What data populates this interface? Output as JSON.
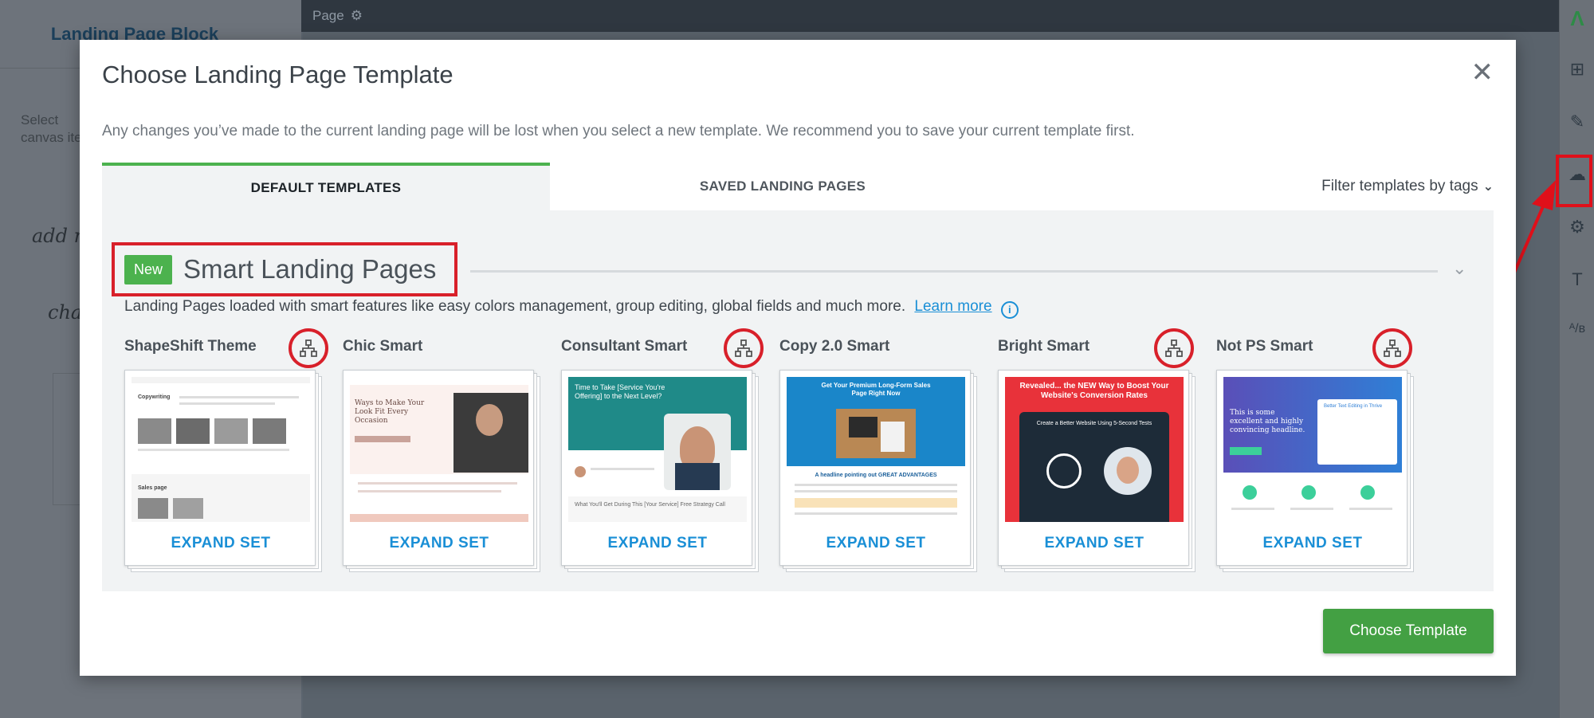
{
  "editor": {
    "left_panel_title": "Landing Page Block",
    "left_panel_hint": "Select canvas ite",
    "left_panel_script_1": "add n elem",
    "left_panel_script_2": "cha tem",
    "topbar_label": "Page"
  },
  "modal": {
    "title": "Choose Landing Page Template",
    "warning": "Any changes you’ve made to the current landing page will be lost when you select a new template. We recommend you to save your current template first.",
    "tabs": [
      {
        "label": "DEFAULT TEMPLATES",
        "active": true
      },
      {
        "label": "SAVED LANDING PAGES",
        "active": false
      }
    ],
    "filter_label": "Filter templates by tags",
    "section": {
      "badge": "New",
      "title": "Smart Landing Pages",
      "description": "Landing Pages loaded with smart features like easy colors management, group editing, global fields and much more.",
      "learn_more": "Learn more",
      "info_glyph": "i"
    },
    "templates": [
      {
        "name": "ShapeShift Theme",
        "expand_label": "EXPAND SET",
        "structure_marked": true
      },
      {
        "name": "Chic Smart",
        "expand_label": "EXPAND SET",
        "structure_marked": false
      },
      {
        "name": "Consultant Smart",
        "expand_label": "EXPAND SET",
        "structure_marked": true
      },
      {
        "name": "Copy 2.0 Smart",
        "expand_label": "EXPAND SET",
        "structure_marked": false
      },
      {
        "name": "Bright Smart",
        "expand_label": "EXPAND SET",
        "structure_marked": true
      },
      {
        "name": "Not PS Smart",
        "expand_label": "EXPAND SET",
        "structure_marked": true
      }
    ],
    "thumbnail_text": {
      "chic_headline": "Ways to Make Your Look Fit Every Occasion",
      "consultant_headline": "Time to Take [Service You're Offering] to the Next Level?",
      "consultant_footer": "What You'll Get During This [Your Service] Free Strategy Call",
      "copy_headline": "Get Your Premium Long-Form Sales Page Right Now",
      "copy_sub": "A headline pointing out GREAT ADVANTAGES",
      "bright_headline": "Revealed... the NEW Way to Boost Your Website's Conversion Rates",
      "bright_sub": "Create a Better Website Using 5-Second Tests",
      "notps_headline": "This is some excellent and highly convincing headline.",
      "notps_side": "Better Text Editing in Thrive",
      "shapeshift_label_1": "Copywriting",
      "shapeshift_label_2": "Sales page"
    },
    "choose_button": "Choose Template",
    "close_glyph": "✕"
  },
  "colors": {
    "accent_green": "#4cb24e",
    "link_blue": "#1a8fd6",
    "annotation_red": "#d8202a"
  }
}
